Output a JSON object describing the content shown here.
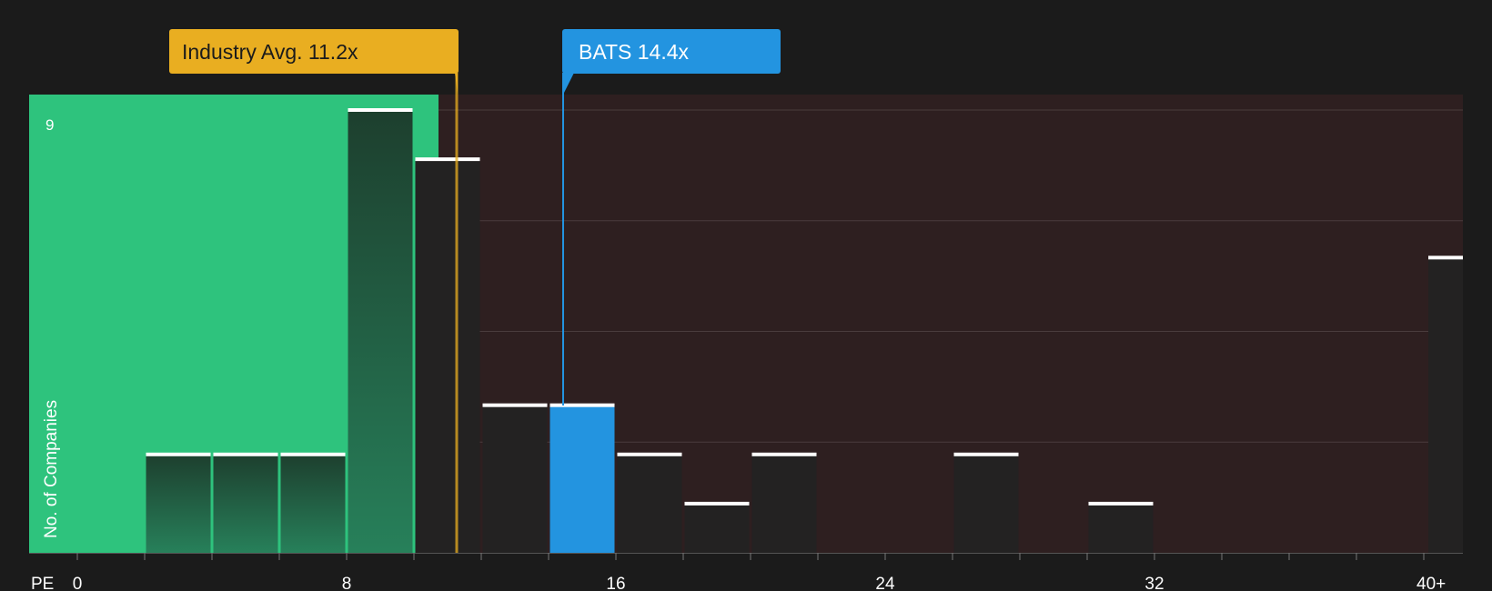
{
  "chart_data": {
    "type": "bar",
    "x_axis_label": "PE",
    "y_axis_label": "No. of Companies",
    "x_tick_labels": [
      {
        "value": 0,
        "label": "0"
      },
      {
        "value": 8,
        "label": "8"
      },
      {
        "value": 16,
        "label": "16"
      },
      {
        "value": 24,
        "label": "24"
      },
      {
        "value": 32,
        "label": "32"
      },
      {
        "value": 41,
        "label": "40+"
      }
    ],
    "y_tick_label": {
      "value": 9,
      "label": "9"
    },
    "xlim": [
      0,
      41
    ],
    "ylim": [
      0,
      9.3
    ],
    "bin_width": 2,
    "bins": [
      {
        "start": 2,
        "count": 2
      },
      {
        "start": 4,
        "count": 2
      },
      {
        "start": 6,
        "count": 2
      },
      {
        "start": 8,
        "count": 9
      },
      {
        "start": 10,
        "count": 8
      },
      {
        "start": 12,
        "count": 3
      },
      {
        "start": 14,
        "count": 3,
        "highlight": true
      },
      {
        "start": 16,
        "count": 2
      },
      {
        "start": 18,
        "count": 1
      },
      {
        "start": 20,
        "count": 2
      },
      {
        "start": 26,
        "count": 2
      },
      {
        "start": 30,
        "count": 1
      },
      {
        "start": 40,
        "count": 6
      }
    ],
    "industry_avg": {
      "value": 11.2,
      "label": "Industry Avg. 11.2x"
    },
    "company": {
      "value": 14.4,
      "label": "BATS 14.4x"
    },
    "colors": {
      "undervalued_zone": "#2ec37d",
      "overvalued_zone": "#2e1f20",
      "bar_dark": "#232222",
      "bar_in_green_zone": "#1d4430",
      "highlight_bar": "#2394e0",
      "industry_avg": "#e9ae21",
      "company": "#2394e0",
      "bar_top": "#ffffff",
      "background": "#1b1b1b"
    }
  }
}
